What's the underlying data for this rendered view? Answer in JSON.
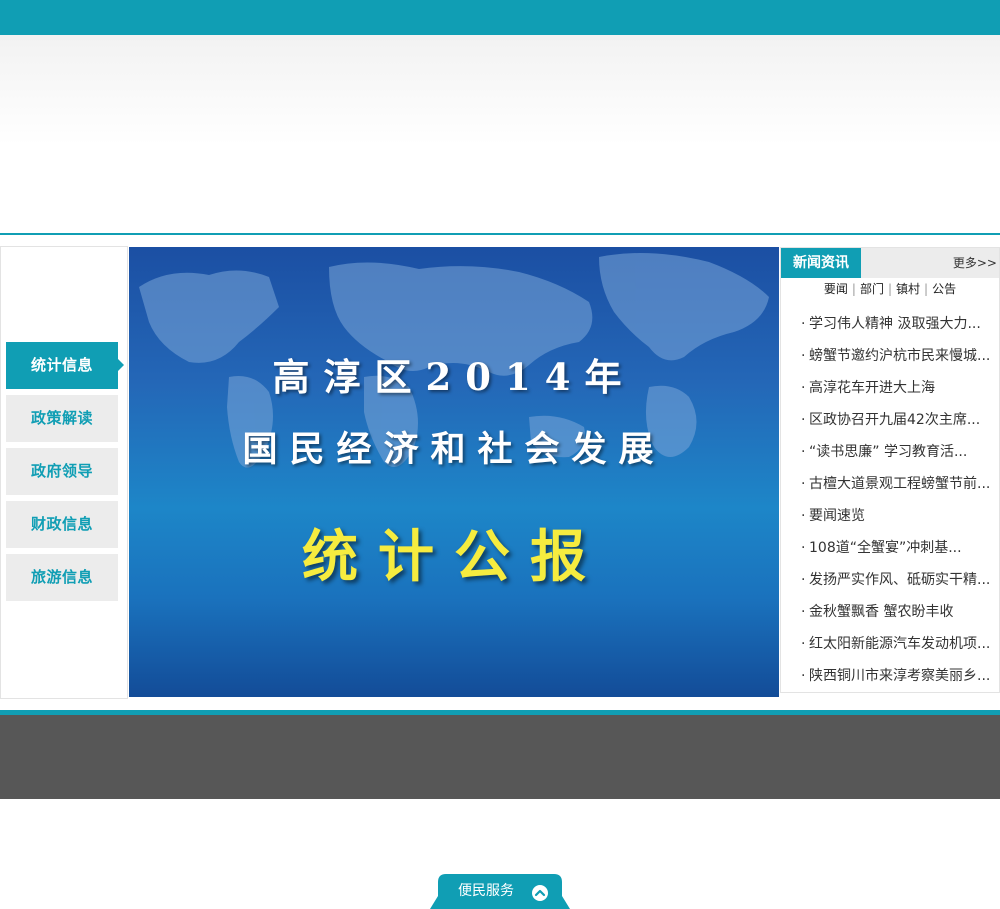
{
  "sidebar": {
    "items": [
      {
        "label": "统计信息",
        "active": true
      },
      {
        "label": "政策解读"
      },
      {
        "label": "政府领导"
      },
      {
        "label": "财政信息"
      },
      {
        "label": "旅游信息"
      }
    ]
  },
  "banner": {
    "line1": "高淳区2014年",
    "line2": "国民经济和社会发展",
    "line3": "统计公报"
  },
  "news": {
    "title": "新闻资讯",
    "more": "更多>>",
    "tabs": [
      "要闻",
      "部门",
      "镇村",
      "公告"
    ],
    "bullet": "·",
    "items": [
      "学习伟人精神 汲取强大力...",
      "螃蟹节邀约沪杭市民来慢城...",
      "高淳花车开进大上海",
      "区政协召开九届42次主席...",
      "“读书思廉” 学习教育活...",
      "古檀大道景观工程螃蟹节前...",
      "要闻速览",
      "108道“全蟹宴”冲刺基...",
      "发扬严实作风、砥砺实干精...",
      "金秋蟹飘香 蟹农盼丰收",
      "红太阳新能源汽车发动机项...",
      "陕西铜川市来淳考察美丽乡..."
    ]
  },
  "service": {
    "label": "便民服务"
  },
  "colors": {
    "accent": "#109eb4",
    "footer": "#575757",
    "banner_highlight": "#f6ec3f"
  }
}
